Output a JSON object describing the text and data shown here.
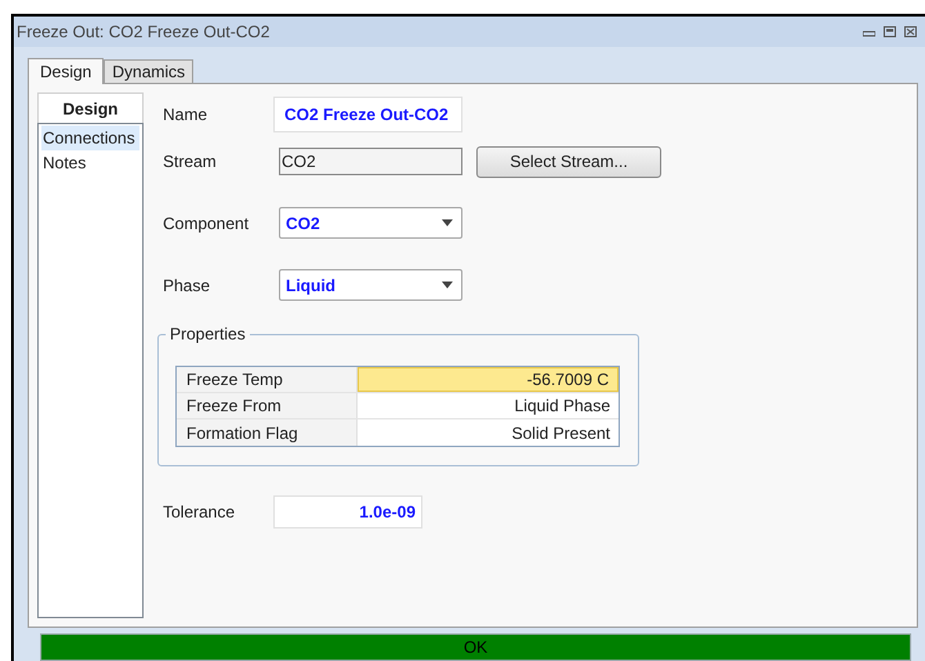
{
  "window": {
    "title": "Freeze Out: CO2 Freeze Out-CO2"
  },
  "tabs": [
    {
      "label": "Design",
      "selected": true
    },
    {
      "label": "Dynamics",
      "selected": false
    }
  ],
  "sidebar": {
    "title": "Design",
    "items": [
      {
        "label": "Connections",
        "selected": true
      },
      {
        "label": "Notes",
        "selected": false
      }
    ]
  },
  "name": {
    "label": "Name",
    "value": "CO2 Freeze Out-CO2"
  },
  "stream": {
    "label": "Stream",
    "value": "CO2",
    "button": "Select Stream..."
  },
  "component": {
    "label": "Component",
    "value": "CO2"
  },
  "phase": {
    "label": "Phase",
    "value": "Liquid"
  },
  "properties": {
    "title": "Properties",
    "rows": [
      {
        "name": "Freeze Temp",
        "value": "-56.7009 C",
        "highlighted": true
      },
      {
        "name": "Freeze From",
        "value": "Liquid Phase",
        "highlighted": false
      },
      {
        "name": "Formation Flag",
        "value": "Solid Present",
        "highlighted": false
      }
    ]
  },
  "tolerance": {
    "label": "Tolerance",
    "value": "1.0e-09"
  },
  "ok_button": "OK"
}
